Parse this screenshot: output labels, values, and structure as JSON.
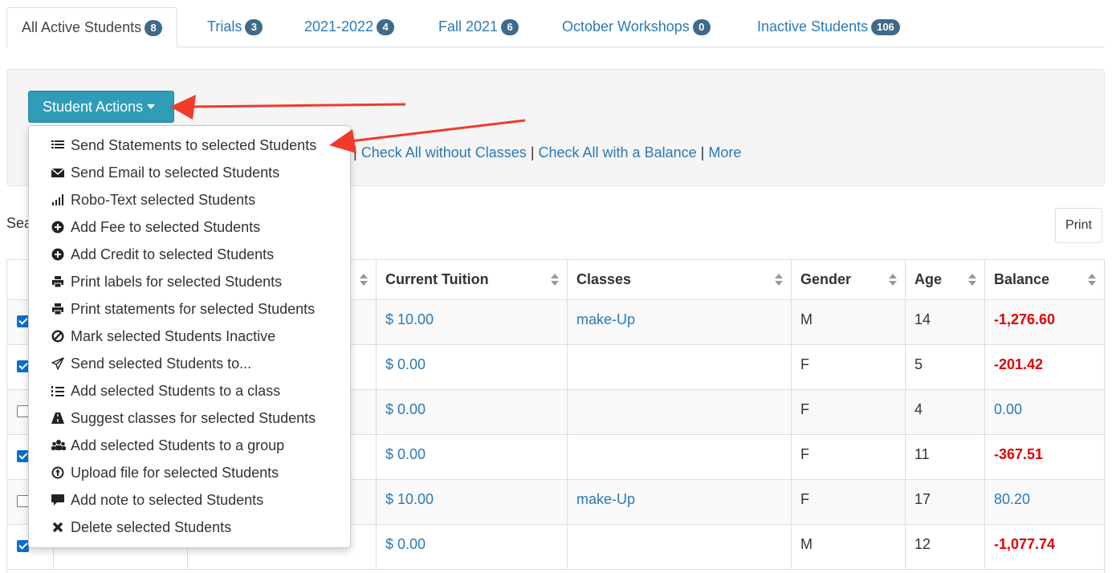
{
  "tabs": [
    {
      "label": "All Active Students",
      "count": "8"
    },
    {
      "label": "Trials",
      "count": "3"
    },
    {
      "label": "2021-2022",
      "count": "4"
    },
    {
      "label": "Fall 2021",
      "count": "6"
    },
    {
      "label": "October Workshops",
      "count": "0"
    },
    {
      "label": "Inactive Students",
      "count": "106"
    }
  ],
  "actions": {
    "button_label": "Student Actions"
  },
  "check_links": {
    "sep": "|",
    "without_classes": "Check All without Classes",
    "with_balance": "Check All with a Balance",
    "more": "More"
  },
  "search": {
    "label_partial": "Sea"
  },
  "print_label": "Print",
  "menu": [
    {
      "label": "Send Statements to selected Students",
      "icon": "list-icon"
    },
    {
      "label": "Send Email to selected Students",
      "icon": "envelope-icon"
    },
    {
      "label": "Robo-Text selected Students",
      "icon": "signal-icon"
    },
    {
      "label": "Add Fee to selected Students",
      "icon": "plus-circle-icon"
    },
    {
      "label": "Add Credit to selected Students",
      "icon": "plus-circle-icon"
    },
    {
      "label": "Print labels for selected Students",
      "icon": "printer-icon"
    },
    {
      "label": "Print statements for selected Students",
      "icon": "printer-icon"
    },
    {
      "label": "Mark selected Students Inactive",
      "icon": "ban-icon"
    },
    {
      "label": "Send selected Students to...",
      "icon": "paper-plane-icon"
    },
    {
      "label": "Add selected Students to a class",
      "icon": "numbered-list-icon"
    },
    {
      "label": "Suggest classes for selected Students",
      "icon": "road-icon"
    },
    {
      "label": "Add selected Students to a group",
      "icon": "group-icon"
    },
    {
      "label": "Upload file for selected Students",
      "icon": "upload-circle-icon"
    },
    {
      "label": "Add note to selected Students",
      "icon": "comment-icon"
    },
    {
      "label": "Delete selected Students",
      "icon": "x-icon"
    }
  ],
  "table": {
    "headers": {
      "tuition": "Current Tuition",
      "classes": "Classes",
      "gender": "Gender",
      "age": "Age",
      "balance": "Balance"
    },
    "rows": [
      {
        "checked": true,
        "tuition": "$ 10.00",
        "classes": "make-Up",
        "gender": "M",
        "age": "14",
        "balance": "-1,276.60",
        "negative": true
      },
      {
        "checked": true,
        "tuition": "$ 0.00",
        "classes": "",
        "gender": "F",
        "age": "5",
        "balance": "-201.42",
        "negative": true
      },
      {
        "checked": false,
        "tuition": "$ 0.00",
        "classes": "",
        "gender": "F",
        "age": "4",
        "balance": "0.00",
        "negative": false
      },
      {
        "checked": true,
        "tuition": "$ 0.00",
        "classes": "",
        "gender": "F",
        "age": "11",
        "balance": "-367.51",
        "negative": true
      },
      {
        "checked": false,
        "tuition": "$ 10.00",
        "classes": "make-Up",
        "gender": "F",
        "age": "17",
        "balance": "80.20",
        "negative": false
      },
      {
        "checked": true,
        "tuition": "$ 0.00",
        "classes": "",
        "gender": "M",
        "age": "12",
        "balance": "-1,077.74",
        "negative": true
      }
    ]
  },
  "colors": {
    "accent": "#2f9cb8",
    "badge": "#3f6a8a",
    "link": "#2a7ab8",
    "negative": "#e00000",
    "annotation_arrow": "#f03a2a"
  }
}
